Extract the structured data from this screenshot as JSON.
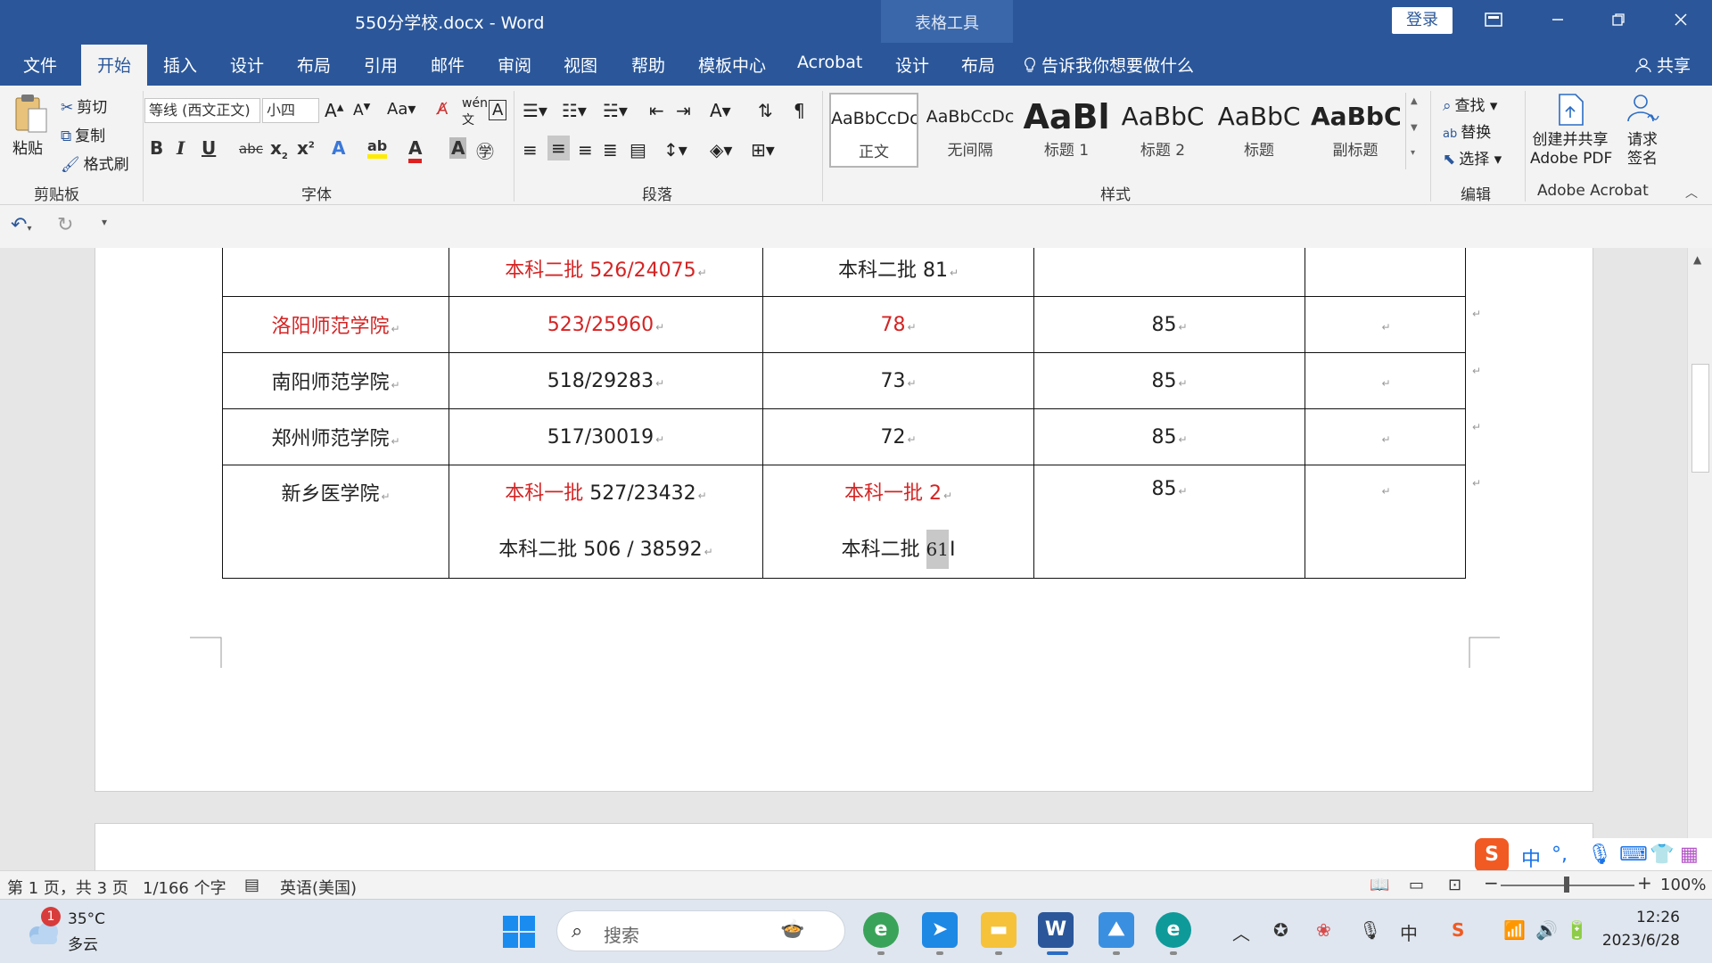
{
  "window": {
    "title": "550分学校.docx  -  Word",
    "context_tab": "表格工具",
    "login": "登录"
  },
  "tabs": {
    "file": "文件",
    "home": "开始",
    "insert": "插入",
    "design": "设计",
    "layout": "布局",
    "references": "引用",
    "mailings": "邮件",
    "review": "审阅",
    "view": "视图",
    "help": "帮助",
    "templates": "模板中心",
    "acrobat": "Acrobat",
    "table_design": "设计",
    "table_layout": "布局",
    "tell_me": "告诉我你想要做什么",
    "share": "共享"
  },
  "ribbon": {
    "clipboard": {
      "label": "剪贴板",
      "paste": "粘贴",
      "cut": "剪切",
      "copy": "复制",
      "format_painter": "格式刷"
    },
    "font": {
      "label": "字体",
      "font_name": "等线 (西文正文)",
      "font_size": "小四"
    },
    "paragraph": {
      "label": "段落"
    },
    "styles": {
      "label": "样式",
      "items": [
        {
          "preview": "AaBbCcDc",
          "name": "正文"
        },
        {
          "preview": "AaBbCcDc",
          "name": "无间隔"
        },
        {
          "preview": "AaBl",
          "name": "标题 1"
        },
        {
          "preview": "AaBbC",
          "name": "标题 2"
        },
        {
          "preview": "AaBbC",
          "name": "标题"
        },
        {
          "preview": "AaBbC",
          "name": "副标题"
        }
      ]
    },
    "editing": {
      "label": "编辑",
      "find": "查找",
      "replace": "替换",
      "select": "选择"
    },
    "acrobat": {
      "label": "Adobe Acrobat",
      "create_line1": "创建并共享",
      "create_line2": "Adobe PDF",
      "sign_line1": "请求",
      "sign_line2": "签名"
    }
  },
  "table": {
    "rows": [
      {
        "c1": "",
        "c2": "本科二批 526/24075",
        "c3": "本科二批 81",
        "c4": "",
        "c5": ""
      },
      {
        "c1": "洛阳师范学院",
        "c2": "523/25960",
        "c3": "78",
        "c4": "85",
        "c5": ""
      },
      {
        "c1": "南阳师范学院",
        "c2": "518/29283",
        "c3": "73",
        "c4": "85",
        "c5": ""
      },
      {
        "c1": "郑州师范学院",
        "c2": "517/30019",
        "c3": "72",
        "c4": "85",
        "c5": ""
      },
      {
        "c1": "新乡医学院",
        "c2a_red": "本科一批",
        "c2a": " 527/23432",
        "c3a": "本科一批 2",
        "c4": "85",
        "c5": "",
        "c2b": "本科二批 506 / 38592",
        "c3b_label": "本科二批 ",
        "c3b_value": "61"
      }
    ]
  },
  "status": {
    "page": "第 1 页，共 3 页",
    "words": "1/166 个字",
    "language": "英语(美国)",
    "zoom": "100%",
    "zoom_level": 1.0
  },
  "ime": {
    "mode": "中"
  },
  "taskbar": {
    "weather_temp": "35°C",
    "weather_desc": "多云",
    "weather_badge": "1",
    "search_placeholder": "搜索",
    "time": "12:26",
    "date": "2023/6/28",
    "tray_lang": "中"
  },
  "colors": {
    "brand": "#2b579a",
    "red_text": "#d42424"
  }
}
